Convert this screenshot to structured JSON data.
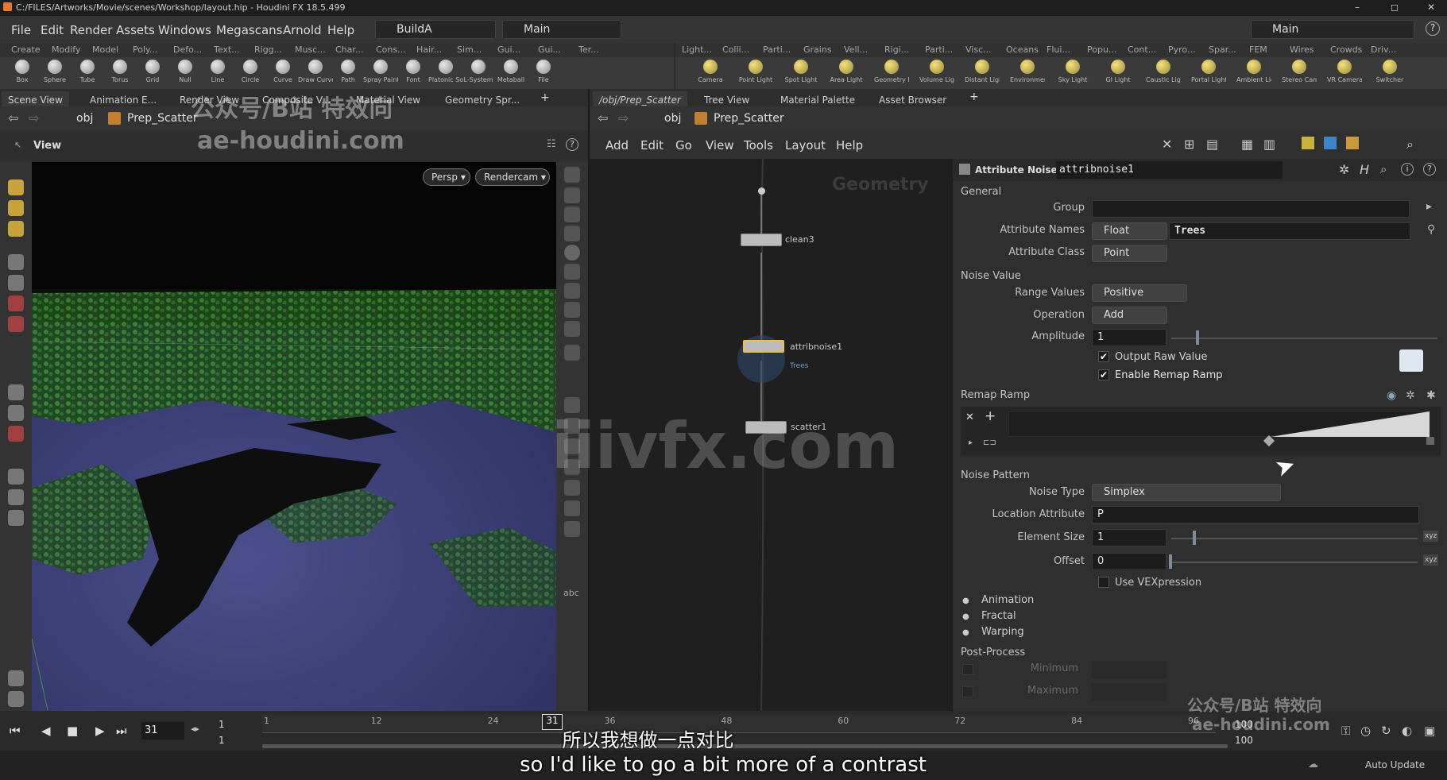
{
  "window": {
    "title": "C:/FILES/Artworks/Movie/scenes/Workshop/layout.hip - Houdini FX 18.5.499"
  },
  "menu": {
    "items": [
      "File",
      "Edit",
      "Render",
      "Assets",
      "Windows",
      "Megascans",
      "Arnold",
      "Help"
    ],
    "desktop": "BuildA",
    "context": "Main",
    "right_context": "Main"
  },
  "shelf_tabs_left": [
    "Create",
    "Modify",
    "Model",
    "Poly...",
    "Defo...",
    "Text...",
    "Rigg...",
    "Musc...",
    "Char...",
    "Cons...",
    "Hair...",
    "Sim...",
    "Gui...",
    "Gui...",
    "Ter..."
  ],
  "shelf_tools_left": [
    "Box",
    "Sphere",
    "Tube",
    "Torus",
    "Grid",
    "Null",
    "Line",
    "Circle",
    "Curve",
    "Draw Curve",
    "Path",
    "Spray Paint",
    "Font",
    "Platonic Solids",
    "L-System",
    "Metaball",
    "File"
  ],
  "shelf_tabs_right": [
    "Light...",
    "Colli...",
    "Parti...",
    "Grains",
    "Vell...",
    "Rigi...",
    "Parti...",
    "Visc...",
    "Oceans",
    "Flui...",
    "Popu...",
    "Cont...",
    "Pyro...",
    "Spar...",
    "FEM",
    "Wires",
    "Crowds",
    "Driv..."
  ],
  "shelf_tools_right": [
    "Camera",
    "Point Light",
    "Spot Light",
    "Area Light",
    "Geometry Light",
    "Volume Light",
    "Distant Light",
    "Environment Light",
    "Sky Light",
    "GI Light",
    "Caustic Light",
    "Portal Light",
    "Ambient Light",
    "Stereo Camera",
    "VR Camera",
    "Switcher"
  ],
  "left_panel_tabs": [
    "Scene View",
    "Animation E...",
    "Render View",
    "Composite V...",
    "Material View",
    "Geometry Spr..."
  ],
  "right_panel_tabs": [
    "/obj/Prep_Scatter",
    "Tree View",
    "Material Palette",
    "Asset Browser"
  ],
  "path": {
    "root": "obj",
    "node": "Prep_Scatter"
  },
  "viewport": {
    "label": "View",
    "persp": "Persp",
    "cam": "Rendercam"
  },
  "network_menu": [
    "Add",
    "Edit",
    "Go",
    "View",
    "Tools",
    "Layout",
    "Help"
  ],
  "network": {
    "context_label": "Geometry",
    "nodes": [
      {
        "name": "clean3"
      },
      {
        "name": "attribnoise1",
        "sub": "Trees"
      },
      {
        "name": "scatter1"
      }
    ]
  },
  "params": {
    "node_type": "Attribute Noise",
    "node_name": "attribnoise1",
    "general_label": "General",
    "group_label": "Group",
    "group_value": "",
    "attrnames_label": "Attribute Names",
    "attr_type": "Float",
    "attr_name": "Trees",
    "attrclass_label": "Attribute Class",
    "attr_class": "Point",
    "noisevalue_label": "Noise Value",
    "range_label": "Range Values",
    "range_value": "Positive",
    "op_label": "Operation",
    "op_value": "Add",
    "amp_label": "Amplitude",
    "amp_value": "1",
    "raw_label": "Output Raw Value",
    "remap_label": "Enable Remap Ramp",
    "ramp_label": "Remap Ramp",
    "pattern_label": "Noise Pattern",
    "noisetype_label": "Noise Type",
    "noisetype_value": "Simplex",
    "loc_label": "Location Attribute",
    "loc_value": "P",
    "elem_label": "Element Size",
    "elem_value": "1",
    "offset_label": "Offset",
    "offset_value": "0",
    "vex_label": "Use VEXpression",
    "folders": [
      "Animation",
      "Fractal",
      "Warping"
    ],
    "post_label": "Post-Process",
    "min_label": "Minimum",
    "max_label": "Maximum"
  },
  "timeline": {
    "frame": "31",
    "start": "1",
    "start2": "1",
    "end": "100",
    "end2": "100",
    "ticks": [
      "1",
      "12",
      "24",
      "31",
      "36",
      "48",
      "60",
      "72",
      "84",
      "96"
    ]
  },
  "status": {
    "auto_update": "Auto Update"
  },
  "subtitles": {
    "cn": "所以我想做一点对比",
    "en": "so I'd like to go a bit more of a contrast"
  },
  "watermarks": {
    "a": "公众号/B站 特效向",
    "b": "ae-houdini.com",
    "c": "iiivfx.com",
    "d": "公众号/B站 特效向",
    "e": "ae-houdini.com"
  }
}
